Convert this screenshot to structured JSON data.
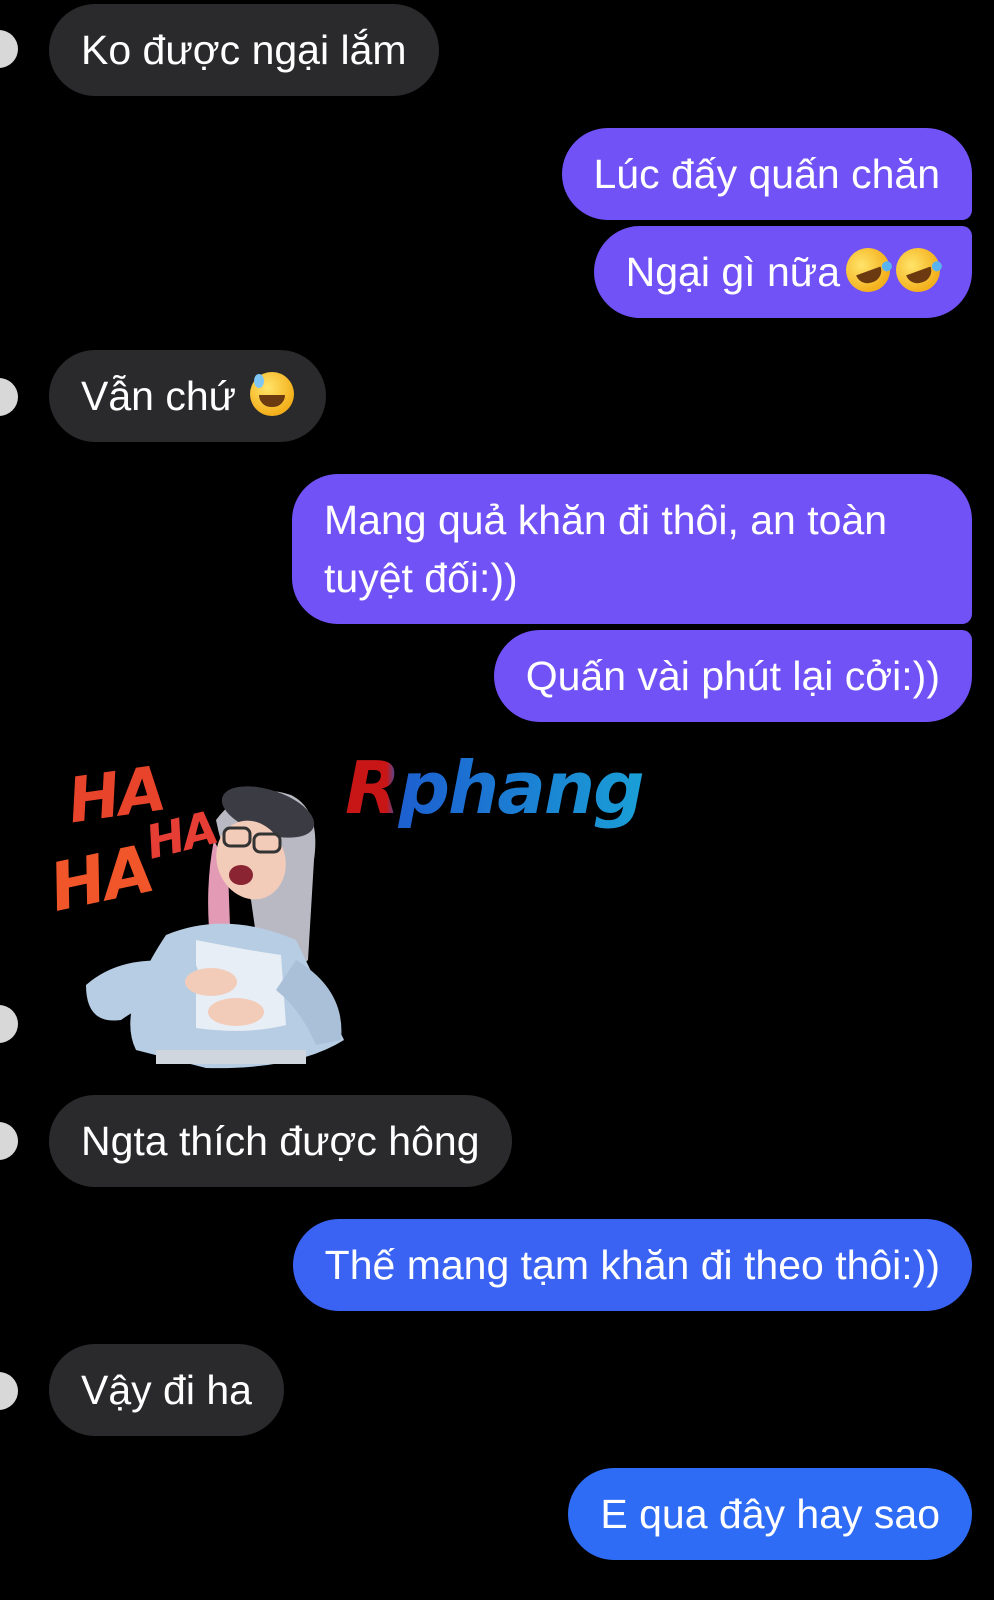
{
  "messages": [
    {
      "side": "incoming",
      "text": "Ko được ngại lắm"
    },
    {
      "side": "outgoing",
      "text": "Lúc đấy quấn chăn"
    },
    {
      "side": "outgoing",
      "text": "Ngại gì nữa",
      "emoji": [
        "rolling-on-floor-laughing-emoji",
        "rolling-on-floor-laughing-emoji"
      ]
    },
    {
      "side": "incoming",
      "text": "Vẫn chứ",
      "emoji": [
        "grinning-sweat-emoji"
      ]
    },
    {
      "side": "outgoing",
      "text": "Mang quả khăn đi thôi, an toàn tuyệt đối:))"
    },
    {
      "side": "outgoing",
      "text": "Quấn vài phút lại cởi:))"
    },
    {
      "side": "incoming",
      "type": "sticker",
      "sticker_text": [
        "HA",
        "HA",
        "HA"
      ]
    },
    {
      "side": "incoming",
      "text": "Ngta thích được hông"
    },
    {
      "side": "outgoing",
      "text": "Thế mang tạm khăn đi theo thôi:))"
    },
    {
      "side": "incoming",
      "text": "Vậy đi ha"
    },
    {
      "side": "outgoing",
      "text": "E qua đây hay sao"
    }
  ],
  "watermark": "Rphang",
  "colors": {
    "background": "#000000",
    "incoming_bubble": "#2a2a2c",
    "outgoing_purple": "#7152f7",
    "outgoing_blue": "#3a63f3",
    "text": "#ffffff"
  }
}
